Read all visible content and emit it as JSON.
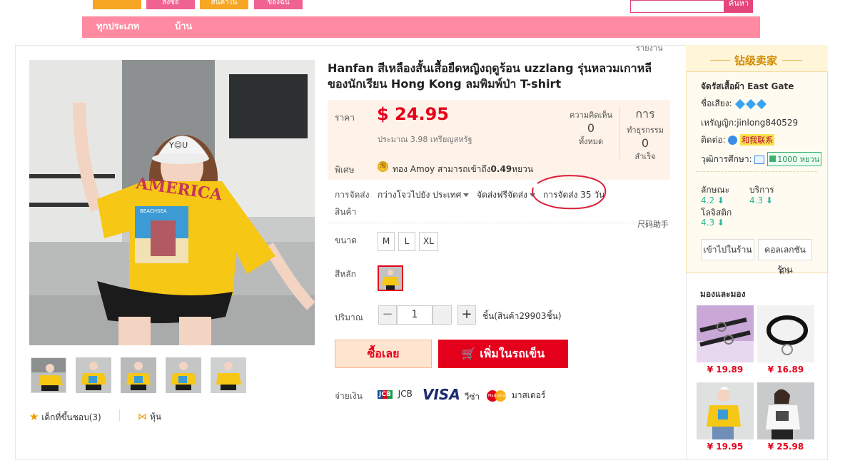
{
  "top_bar": {
    "buttons": [
      "สั่งซื้อ",
      "สินค้าใน",
      "ของฉัน"
    ],
    "search_button": "ค้นหา"
  },
  "nav": {
    "items": [
      "ทุกประเภท",
      "บ้าน"
    ]
  },
  "report_link": "รายงาน",
  "product": {
    "title": "Hanfan สีเหลืองสั้นเสื้อยืดหญิงฤดูร้อน uzzlang รุ่นหลวมเกาหลีของนักเรียน Hong Kong ลมพิมพ์ป่า T-shirt",
    "price_label": "ราคา",
    "price": "$ 24.95",
    "approx": "ประมาณ 3.98 เหรียญสหรัฐ",
    "reviews_label": "ความคิดเห็น",
    "reviews_count": "0",
    "reviews_total_label": "ทั้งหมด",
    "trans_label_1": "การ",
    "trans_label_2": "ทำธุรกรรม",
    "trans_count": "0",
    "trans_done_label": "สำเร็จ",
    "special_label": "พิเศษ",
    "special_text_pre": "ทอง Amoy สามารถเข้าถึง",
    "special_amount": "0.49",
    "special_text_post": "หยวน",
    "coin_icon": "淘",
    "shipping_label_1": "การจัดส่ง",
    "shipping_label_2": "สินค้า",
    "ship_from": "กว่างโจวไปยัง ประเทศ",
    "ship_free": "จัดส่งฟรีจัดส่ง",
    "ship_days": "การจัดส่ง 35 วัน",
    "size_helper": "尺码助手",
    "size_label": "ขนาด",
    "sizes": [
      "M",
      "L",
      "XL"
    ],
    "color_label": "สีหลัก",
    "qty_label": "ปริมาณ",
    "qty_minus": "−",
    "qty_value": "1",
    "qty_plus": "+",
    "stock": "ชิ้น(สินค้า29903ชิ้น)",
    "buy_now": "ซื้อเลย",
    "add_cart": "เพิ่มในรถเข็น",
    "pay_label": "จ่ายเงิน",
    "pay_methods": {
      "jcb_logo": "JCB",
      "jcb": "JCB",
      "visa_logo": "VISA",
      "visa": "วีซ่า",
      "master_logo": "MasterCard",
      "master": "มาสเตอร์"
    },
    "fav": "เด็กที่ขึ้นชอบ(3)",
    "share": "หุ้น",
    "shirt_print": "AMERICA",
    "beach_print": "BEACHSEA",
    "cap_print": "Y☺U"
  },
  "seller": {
    "badge": "钻级卖家",
    "store": "จัดรัสเสื้อผ้า East Gate",
    "rep_label": "ชื่อเสียง:",
    "merchant": "เหรัญญิก:jinlong840529",
    "contact_label": "ติดต่อ:",
    "contact_tag": "和我联系",
    "edu_label": "วุฒิการศึกษา:",
    "edu_tag": "1000 หยวน",
    "r1_label": "ลักษณะ",
    "r1_val": "4.2",
    "r2_label": "บริการ",
    "r2_val": "4.3",
    "r3_label": "โลจิสติก",
    "r3_val": "4.3",
    "btn_enter": "เข้าไปในร้าน",
    "btn_collect_1": "คอลเลกชันร้าน",
    "btn_collect_2": "ค้า"
  },
  "look": {
    "title": "มองและมอง",
    "prices": [
      "¥ 19.89",
      "¥ 16.89",
      "¥ 19.95",
      "¥ 25.98"
    ]
  },
  "colors": {
    "accent_red": "#e4001b",
    "nav_pink": "#ff8aa1",
    "orange_tab": "#f6a623",
    "seller_gold": "#d18b00"
  }
}
